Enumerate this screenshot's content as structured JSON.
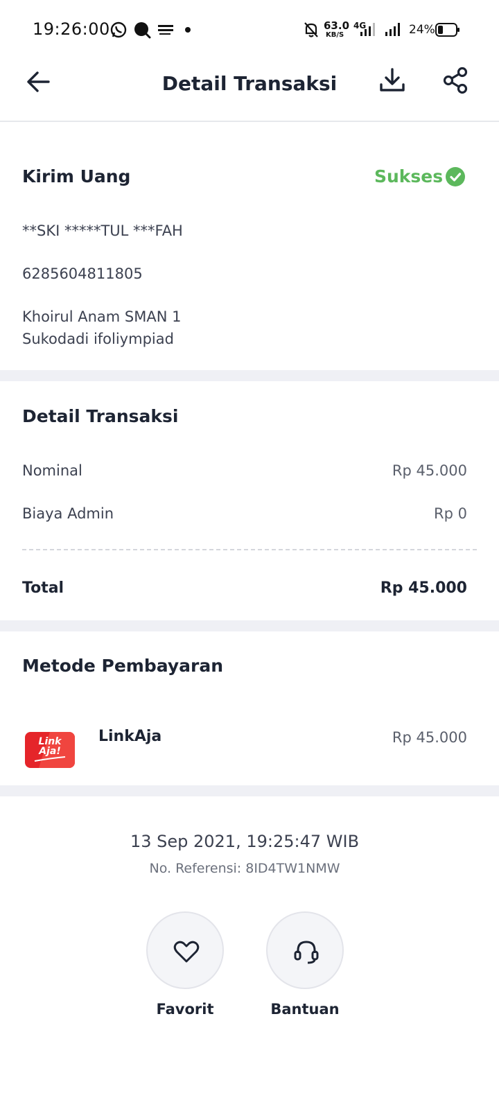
{
  "status_bar": {
    "time": "19:26:00",
    "net_speed": "63.0",
    "net_unit": "KB/S",
    "network_type": "4G",
    "battery": "24%"
  },
  "header": {
    "title": "Detail Transaksi",
    "back_icon": "arrow-left-icon",
    "download_icon": "download-icon",
    "share_icon": "share-icon"
  },
  "transfer": {
    "type": "Kirim Uang",
    "status": "Sukses",
    "status_color": "#5cb85c",
    "recipient_name": "**SKI *****TUL ***FAH",
    "recipient_number": "6285604811805",
    "note_line1": "Khoirul Anam SMAN 1",
    "note_line2": "Sukodadi ifoliympiad"
  },
  "details": {
    "title": "Detail Transaksi",
    "nominal_label": "Nominal",
    "nominal_value": "Rp 45.000",
    "admin_label": "Biaya Admin",
    "admin_value": "Rp 0",
    "total_label": "Total",
    "total_value": "Rp 45.000"
  },
  "payment": {
    "title": "Metode Pembayaran",
    "logo_line1": "Link",
    "logo_line2": "Aja!",
    "method": "LinkAja",
    "amount": "Rp 45.000",
    "brand_color": "#e5252a"
  },
  "footer": {
    "datetime": "13 Sep 2021, 19:25:47 WIB",
    "reference": "No. Referensi: 8ID4TW1NMW",
    "favorite_label": "Favorit",
    "help_label": "Bantuan"
  }
}
